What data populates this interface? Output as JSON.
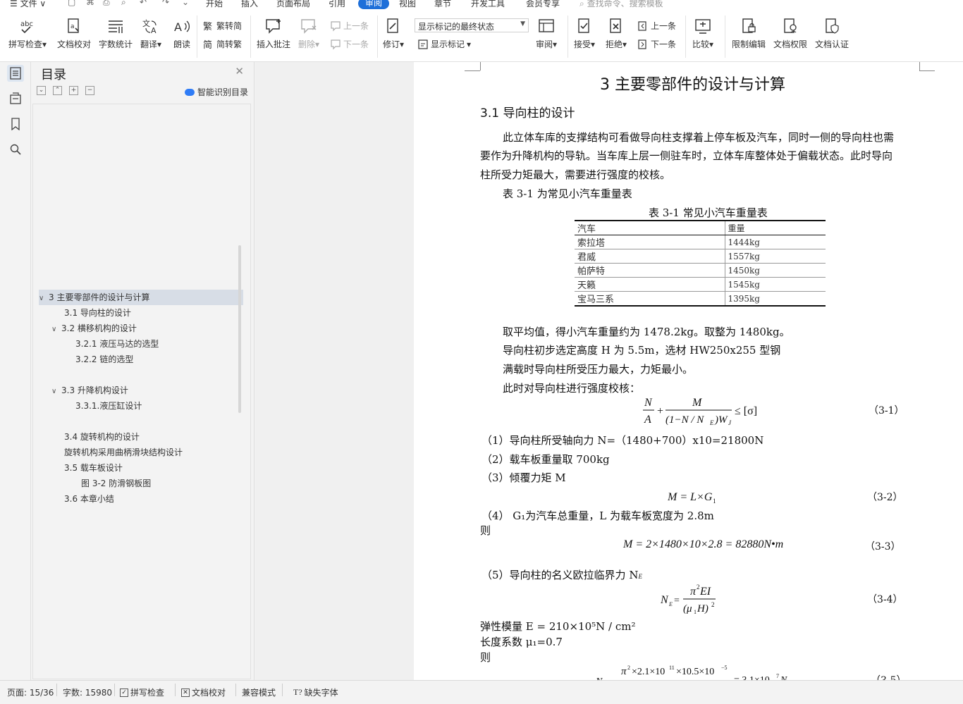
{
  "menubar": {
    "file": "文件",
    "tabs": [
      "开始",
      "插入",
      "页面布局",
      "引用",
      "审阅",
      "视图",
      "章节",
      "开发工具",
      "会员专享"
    ],
    "active_tab": "审阅",
    "search_placeholder": "查找命令、搜索模板"
  },
  "ribbon": {
    "spell_check": "拼写检查",
    "doc_proof": "文档校对",
    "word_count": "字数统计",
    "translate": "翻译",
    "read_aloud": "朗读",
    "trad_to_simp": "繁转简",
    "simp_to_trad": "简转繁",
    "insert_comment": "插入批注",
    "delete": "删除",
    "prev_item": "上一条",
    "next_item": "下一条",
    "track_changes": "修订",
    "display_mode": "显示标记的最终状态",
    "show_markup": "显示标记",
    "review": "审阅",
    "accept": "接受",
    "reject": "拒绝",
    "prev_change": "上一条",
    "next_change": "下一条",
    "compare": "比较",
    "restrict_edit": "限制编辑",
    "doc_permission": "文档权限",
    "doc_cert": "文档认证"
  },
  "toc": {
    "title": "目录",
    "smart_recognize": "智能识别目录",
    "items": [
      {
        "text": "3 主要零部件的设计与计算",
        "caret": "∨",
        "selected": true
      },
      {
        "text": "3.1 导向柱的设计",
        "caret": ""
      },
      {
        "text": "3.2 横移机构的设计",
        "caret": "∨"
      },
      {
        "text": "3.2.1 液压马达的选型",
        "caret": ""
      },
      {
        "text": "3.2.2 链的选型",
        "caret": ""
      },
      {
        "text": "3.3 升降机构设计",
        "caret": "∨"
      },
      {
        "text": "3.3.1.液压缸设计",
        "caret": ""
      },
      {
        "text": "3.4 旋转机构的设计",
        "caret": ""
      },
      {
        "text": "旋转机构采用曲柄滑块结构设计",
        "caret": ""
      },
      {
        "text": "3.5  载车板设计",
        "caret": ""
      },
      {
        "text": "图  3-2 防滑钢板图",
        "caret": ""
      },
      {
        "text": "3.6 本章小结",
        "caret": ""
      }
    ]
  },
  "document": {
    "chapter_title": "3 主要零部件的设计与计算",
    "section_title": "3.1 导向柱的设计",
    "para1_line1": "此立体车库的支撑结构可看做导向柱支撑着上停车板及汽车，同时一侧的导向柱也需",
    "para1_line2": "要作为升降机构的导轨。当车库上层一侧驻车时，立体车库整体处于偏载状态。此时导向",
    "para1_line3": "柱所受力矩最大，需要进行强度的校核。",
    "table_intro": "表 3-1 为常见小汽车重量表",
    "table_caption": "表 3-1 常见小汽车重量表",
    "table_header": [
      "汽车",
      "重量"
    ],
    "table_rows": [
      [
        "索拉塔",
        "1444kg"
      ],
      [
        "君威",
        "1557kg"
      ],
      [
        "帕萨特",
        "1450kg"
      ],
      [
        "天籁",
        "1545kg"
      ],
      [
        "宝马三系",
        "1395kg"
      ]
    ],
    "avg_line": "取平均值，得小汽车重量约为 1478.2kg。取整为 1480kg。",
    "height_line": "导向柱初步选定高度 H 为 5.5m，选材 HW250x255 型钢",
    "load_line": "满载时导向柱所受压力最大，力矩最小。",
    "check_line": "此时对导向柱进行强度校核：",
    "eq1_no": "（3-1）",
    "item1": "（1）导向柱所受轴向力 N=（1480+700）x10=21800N",
    "item2": "（2）载车板重量取 700kg",
    "item3": "（3）倾覆力矩 M",
    "eq2_no": "（3-2）",
    "item4": "（4）  G₁为汽车总重量，L 为载车板宽度为 2.8m",
    "ze1": "则",
    "eq3": "M = 2×1480×10×2.8 = 82880N•m",
    "eq3_no": "（3-3）",
    "item5": "（5）导向柱的名义欧拉临界力 N",
    "eq4_no": "（3-4）",
    "modulus": "弹性模量 E = 210×10⁵N / cm²",
    "length_coef": "长度系数 μ₁=0.7",
    "ze2": "则",
    "eq5_no": "（3-5）"
  },
  "status": {
    "page": "页面: 15/36",
    "words": "字数: 15980",
    "spell": "拼写检查",
    "proof": "文档校对",
    "compat": "兼容模式",
    "missing_font": "缺失字体"
  }
}
